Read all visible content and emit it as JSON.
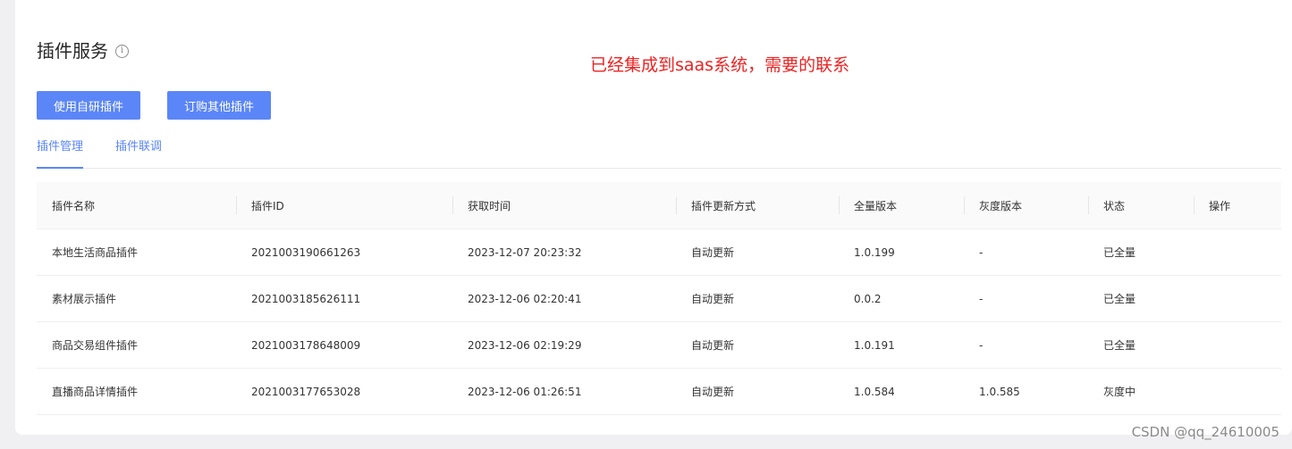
{
  "page": {
    "title": "插件服务",
    "info_icon": "info-circle-icon",
    "annotation": "已经集成到saas系统，需要的联系",
    "watermark": "CSDN @qq_24610005"
  },
  "buttons": {
    "use_own": "使用自研插件",
    "order_other": "订购其他插件"
  },
  "tabs": [
    {
      "label": "插件管理",
      "active": true
    },
    {
      "label": "插件联调",
      "active": false
    }
  ],
  "table": {
    "headers": [
      "插件名称",
      "插件ID",
      "获取时间",
      "插件更新方式",
      "全量版本",
      "灰度版本",
      "状态",
      "操作"
    ],
    "rows": [
      [
        "本地生活商品插件",
        "2021003190661263",
        "2023-12-07 20:23:32",
        "自动更新",
        "1.0.199",
        "-",
        "已全量",
        ""
      ],
      [
        "素材展示插件",
        "2021003185626111",
        "2023-12-06 02:20:41",
        "自动更新",
        "0.0.2",
        "-",
        "已全量",
        ""
      ],
      [
        "商品交易组件插件",
        "2021003178648009",
        "2023-12-06 02:19:29",
        "自动更新",
        "1.0.191",
        "-",
        "已全量",
        ""
      ],
      [
        "直播商品详情插件",
        "2021003177653028",
        "2023-12-06 01:26:51",
        "自动更新",
        "1.0.584",
        "1.0.585",
        "灰度中",
        ""
      ]
    ]
  },
  "colors": {
    "accent": "#5b86f8",
    "annotation": "#ee2222",
    "background": "#f0f0f2"
  }
}
